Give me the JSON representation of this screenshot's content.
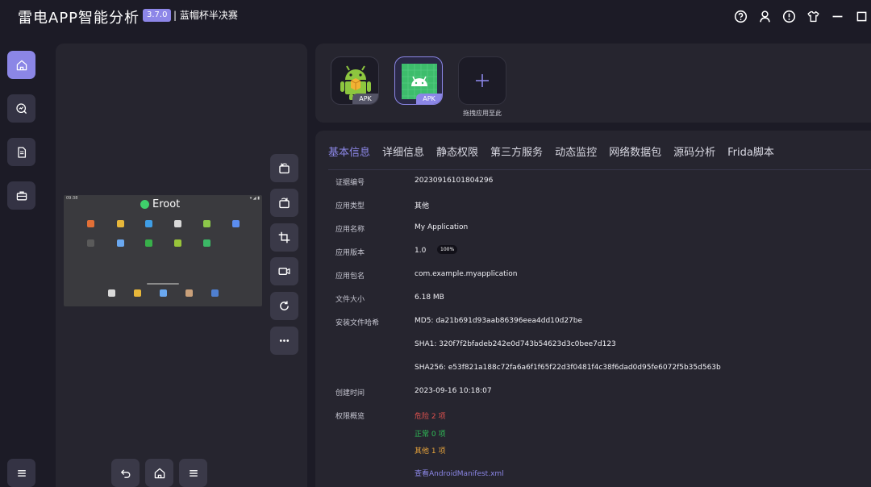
{
  "header": {
    "title": "雷电APP智能分析",
    "version": "3.7.0",
    "event": "| 蓝帽杯半决赛"
  },
  "window_icons": [
    "help-icon",
    "user-icon",
    "alert-icon",
    "skin-icon",
    "minimize-icon",
    "maximize-icon"
  ],
  "nav": [
    "home-icon",
    "analysis-icon",
    "document-icon",
    "toolbox-icon",
    "menu-icon"
  ],
  "device": {
    "screen_status_left": "09:38",
    "screen_status_right": "▾ ◢ ▮",
    "root_label": "Eroot"
  },
  "apks": [
    {
      "tag": "APK"
    },
    {
      "tag": "APK"
    }
  ],
  "add_label": "拖拽应用至此",
  "tabs": [
    "基本信息",
    "详细信息",
    "静态权限",
    "第三方服务",
    "动态监控",
    "网络数据包",
    "源码分析",
    "Frida脚本"
  ],
  "info": {
    "cert_label": "证据编号",
    "cert_value": "20230916101804296",
    "type_label": "应用类型",
    "type_value": "其他",
    "name_label": "应用名称",
    "name_value": "My Application",
    "version_label": "应用版本",
    "version_value": "1.0",
    "version_badge": "100%",
    "package_label": "应用包名",
    "package_value": "com.example.myapplication",
    "size_label": "文件大小",
    "size_value": "6.18 MB",
    "hash_label": "安装文件哈希",
    "md5": "MD5: da21b691d93aab86396eea4dd10d27be",
    "sha1": "SHA1: 320f7f2bfadeb242e0d743b54623d3c0bee7d123",
    "sha256": "SHA256: e53f821a188c72fa6a6f1f65f22d3f0481f4c38f6dad0d95fe6072f5b35d563b",
    "created_label": "创建时间",
    "created_value": "2023-09-16 10:18:07",
    "perm_label": "权限概览",
    "perm_danger": "危险 2 项",
    "perm_normal": "正常 0 项",
    "perm_other": "其他 1 项",
    "manifest_link": "查看AndroidManifest.xml"
  },
  "colors": {
    "accent": "#8b86e6",
    "danger": "#e0524f",
    "normal": "#2fbf57",
    "other": "#e9a53b"
  }
}
